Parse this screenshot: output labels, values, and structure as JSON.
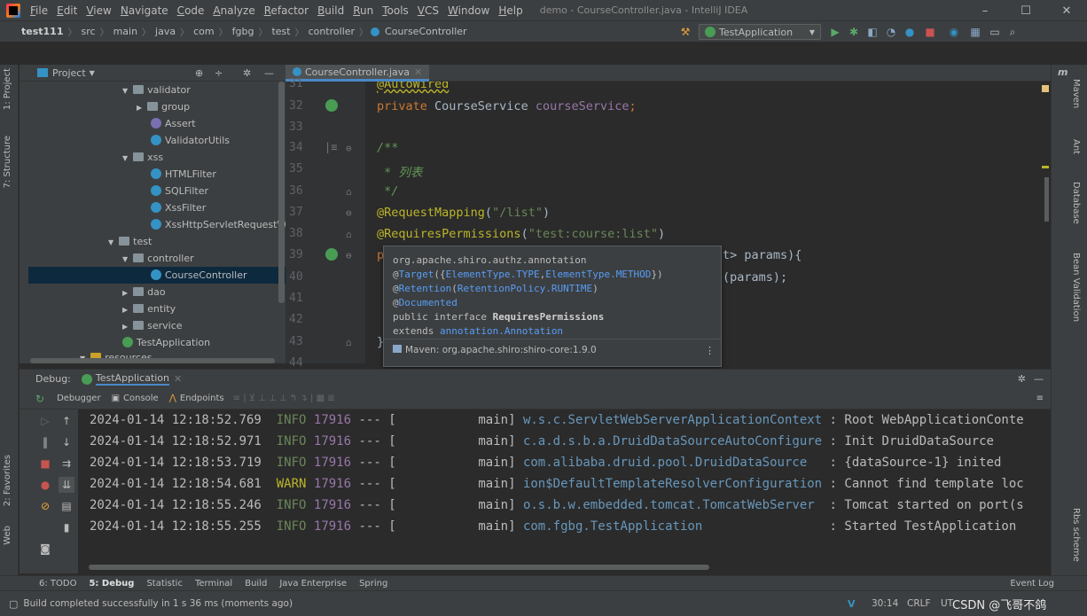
{
  "window": {
    "menu": [
      "File",
      "Edit",
      "View",
      "Navigate",
      "Code",
      "Analyze",
      "Refactor",
      "Build",
      "Run",
      "Tools",
      "VCS",
      "Window",
      "Help"
    ],
    "title": "demo - CourseController.java - IntelliJ IDEA",
    "controls": {
      "minimize": "–",
      "maximize": "☐",
      "close": "✕"
    }
  },
  "breadcrumbs": [
    "test111",
    "src",
    "main",
    "java",
    "com",
    "fgbg",
    "test",
    "controller",
    "CourseController"
  ],
  "toolbar": {
    "run_config": "TestApplication"
  },
  "left_stripe": {
    "project": "1: Project",
    "structure": "7: Structure",
    "favorites": "2: Favorites",
    "web": "Web"
  },
  "project_panel": {
    "title": "Project",
    "items": [
      {
        "label": "validator",
        "kind": "folder",
        "arrow": "▼"
      },
      {
        "label": "group",
        "kind": "folder",
        "arrow": "▶"
      },
      {
        "label": "Assert",
        "kind": "class"
      },
      {
        "label": "ValidatorUtils",
        "kind": "class"
      },
      {
        "label": "xss",
        "kind": "folder",
        "arrow": "▼"
      },
      {
        "label": "HTMLFilter",
        "kind": "class"
      },
      {
        "label": "SQLFilter",
        "kind": "class"
      },
      {
        "label": "XssFilter",
        "kind": "class"
      },
      {
        "label": "XssHttpServletRequestW",
        "kind": "class"
      },
      {
        "label": "test",
        "kind": "folder",
        "arrow": "▼"
      },
      {
        "label": "controller",
        "kind": "folder",
        "arrow": "▼"
      },
      {
        "label": "CourseController",
        "kind": "class"
      },
      {
        "label": "dao",
        "kind": "folder",
        "arrow": "▶"
      },
      {
        "label": "entity",
        "kind": "folder",
        "arrow": "▶"
      },
      {
        "label": "service",
        "kind": "folder",
        "arrow": "▶"
      },
      {
        "label": "TestApplication",
        "kind": "class"
      },
      {
        "label": "resources",
        "kind": "folder",
        "arrow": "▼"
      }
    ]
  },
  "editor": {
    "tab": "CourseController.java",
    "line_numbers": [
      "31",
      "32",
      "33",
      "34",
      "35",
      "36",
      "37",
      "38",
      "39",
      "40",
      "41",
      "42",
      "43",
      "44"
    ],
    "lines": {
      "l31": "@AutoWired",
      "l32_kw": "private ",
      "l32_type": "CourseService ",
      "l32_field": "courseService",
      "l32_end": ";",
      "l34": "/**",
      "l35": " * 列表",
      "l36": " */",
      "l37_an": "@RequestMapping",
      "l37_a": "(",
      "l37_s": "\"/list\"",
      "l37_b": ")",
      "l38_an": "@RequiresPermissions",
      "l38_a": "(",
      "l38_s": "\"test:course:list\"",
      "l38_b": ")",
      "l39_a": "p",
      "l39_b": "t> params){",
      "l40": "(params);",
      "l43": "}"
    }
  },
  "popup": {
    "package": "org.apache.shiro.authz.annotation",
    "target_pre": "@",
    "target": "Target",
    "target_args_a": "({",
    "target_type": "ElementType.TYPE",
    "target_comma": ",",
    "target_method": "ElementType.METHOD",
    "target_args_b": "})",
    "retention_pre": "@",
    "retention": "Retention",
    "retention_args_a": "(",
    "retention_val": "RetentionPolicy.RUNTIME",
    "retention_args_b": ")",
    "documented_pre": "@",
    "documented": "Documented",
    "decl_a": "public interface ",
    "decl_name": "RequiresPermissions",
    "extends_a": "extends ",
    "extends_val": "annotation.Annotation",
    "maven": "Maven: org.apache.shiro:shiro-core:1.9.0",
    "more": "⋮"
  },
  "debug": {
    "label": "Debug:",
    "tab": "TestApplication",
    "subtabs": [
      "Debugger",
      "Console",
      "Endpoints"
    ],
    "logs": [
      {
        "ts": "2024-01-14 12:18:52.769",
        "level": "INFO",
        "pid": "17916",
        "sep": "--- [",
        "thread": "main]",
        "logger": "w.s.c.ServletWebServerApplicationContext",
        "msg": ": Root WebApplicationConte"
      },
      {
        "ts": "2024-01-14 12:18:52.971",
        "level": "INFO",
        "pid": "17916",
        "sep": "--- [",
        "thread": "main]",
        "logger": "c.a.d.s.b.a.DruidDataSourceAutoConfigure",
        "msg": ": Init DruidDataSource"
      },
      {
        "ts": "2024-01-14 12:18:53.719",
        "level": "INFO",
        "pid": "17916",
        "sep": "--- [",
        "thread": "main]",
        "logger": "com.alibaba.druid.pool.DruidDataSource",
        "msg": ": {dataSource-1} inited"
      },
      {
        "ts": "2024-01-14 12:18:54.681",
        "level": "WARN",
        "pid": "17916",
        "sep": "--- [",
        "thread": "main]",
        "logger": "ion$DefaultTemplateResolverConfiguration",
        "msg": ": Cannot find template loc"
      },
      {
        "ts": "2024-01-14 12:18:55.246",
        "level": "INFO",
        "pid": "17916",
        "sep": "--- [",
        "thread": "main]",
        "logger": "o.s.b.w.embedded.tomcat.TomcatWebServer",
        "msg": ": Tomcat started on port(s"
      },
      {
        "ts": "2024-01-14 12:18:55.255",
        "level": "INFO",
        "pid": "17916",
        "sep": "--- [",
        "thread": "main]",
        "logger": "com.fgbg.TestApplication",
        "msg": ": Started TestApplication"
      }
    ]
  },
  "right_stripe": [
    "Maven",
    "Ant",
    "Database",
    "Bean Validation",
    "Rbs scheme"
  ],
  "tool_windows": [
    "6: TODO",
    "5: Debug",
    "Statistic",
    "Terminal",
    "Build",
    "Java Enterprise",
    "Spring"
  ],
  "event_log": "Event Log",
  "status": {
    "message": "Build completed successfully in 1 s 36 ms (moments ago)",
    "position": "30:14",
    "line_sep": "CRLF",
    "encoding": "UT",
    "watermark": "CSDN @飞哥不鸽"
  },
  "colors": {
    "accent": "#4a88c7",
    "keyword": "#cc7832",
    "annotation": "#bbb529",
    "string": "#6a8759",
    "field": "#9876aa",
    "info": "#6a8759"
  }
}
